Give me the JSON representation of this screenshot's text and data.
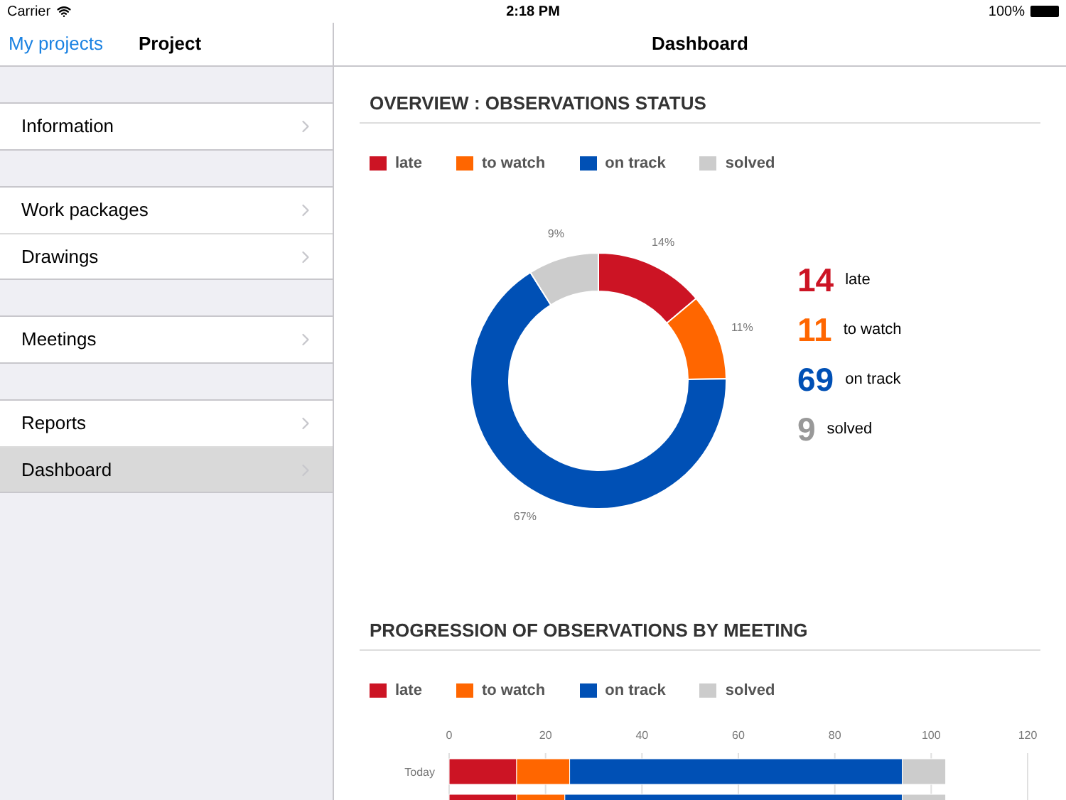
{
  "status_bar": {
    "carrier": "Carrier",
    "time": "2:18 PM",
    "battery": "100%"
  },
  "sidebar": {
    "back_link": "My projects",
    "title": "Project",
    "groups": [
      {
        "items": [
          {
            "label": "Information",
            "selected": false
          }
        ]
      },
      {
        "items": [
          {
            "label": "Work packages",
            "selected": false
          },
          {
            "label": "Drawings",
            "selected": false
          }
        ]
      },
      {
        "items": [
          {
            "label": "Meetings",
            "selected": false
          }
        ]
      },
      {
        "items": [
          {
            "label": "Reports",
            "selected": false
          },
          {
            "label": "Dashboard",
            "selected": true
          }
        ]
      }
    ]
  },
  "main": {
    "title": "Dashboard",
    "overview": {
      "heading": "OVERVIEW : OBSERVATIONS STATUS",
      "chart_data": {
        "type": "donut",
        "categories": [
          "late",
          "to watch",
          "on track",
          "solved"
        ],
        "colors": [
          "#cc1424",
          "#ff6600",
          "#0050b5",
          "#cccccc"
        ],
        "values": [
          14,
          11,
          67,
          9
        ],
        "value_labels": [
          "14%",
          "11%",
          "67%",
          "9%"
        ]
      },
      "totals": [
        {
          "count": "14",
          "label": "late",
          "color": "#cc1424"
        },
        {
          "count": "11",
          "label": "to watch",
          "color": "#ff6600"
        },
        {
          "count": "69",
          "label": "on track",
          "color": "#0050b5"
        },
        {
          "count": "9",
          "label": "solved",
          "color": "#999999"
        }
      ]
    },
    "progression": {
      "heading": "PROGRESSION OF OBSERVATIONS BY MEETING",
      "chart_data": {
        "type": "bar",
        "orientation": "horizontal",
        "stacked": true,
        "grid": true,
        "categories": [
          "Today",
          null
        ],
        "xlim": [
          0,
          120
        ],
        "xticks": [
          0,
          20,
          40,
          60,
          80,
          100,
          120
        ],
        "series": [
          {
            "name": "late",
            "color": "#cc1424",
            "values": [
              14,
              14
            ]
          },
          {
            "name": "to watch",
            "color": "#ff6600",
            "values": [
              11,
              10
            ]
          },
          {
            "name": "on track",
            "color": "#0050b5",
            "values": [
              69,
              70
            ]
          },
          {
            "name": "solved",
            "color": "#cccccc",
            "values": [
              9,
              9
            ]
          }
        ]
      }
    }
  }
}
